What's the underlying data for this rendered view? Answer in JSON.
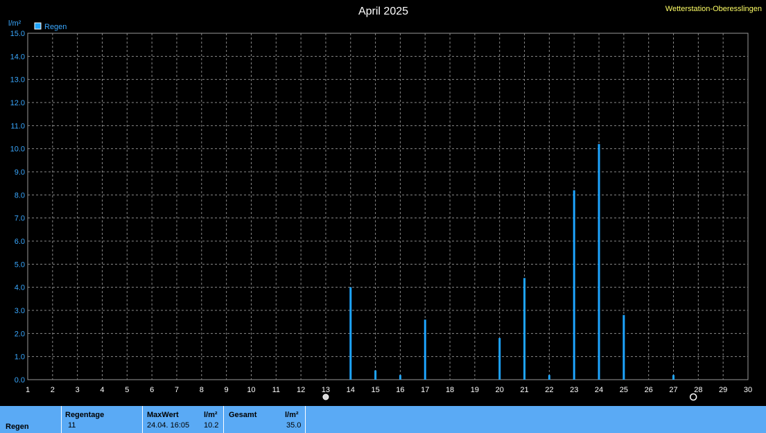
{
  "station": "Wetterstation-Oberesslingen",
  "chart_data": {
    "type": "bar",
    "title": "April 2025",
    "ylabel": "l/m²",
    "ylim": [
      0,
      15
    ],
    "xlim": [
      1,
      30
    ],
    "grid": true,
    "legend_placement": "top-left",
    "y_ticks": [
      "0.0",
      "1.0",
      "2.0",
      "3.0",
      "4.0",
      "5.0",
      "6.0",
      "7.0",
      "8.0",
      "9.0",
      "10.0",
      "11.0",
      "12.0",
      "13.0",
      "14.0",
      "15.0"
    ],
    "x_ticks": [
      "1",
      "2",
      "3",
      "4",
      "5",
      "6",
      "7",
      "8",
      "9",
      "10",
      "11",
      "12",
      "13",
      "14",
      "15",
      "16",
      "17",
      "18",
      "19",
      "20",
      "21",
      "22",
      "23",
      "24",
      "25",
      "26",
      "27",
      "28",
      "29",
      "30"
    ],
    "series": [
      {
        "name": "Regen",
        "color": "#1ea5ff",
        "points": [
          {
            "x": 14,
            "y": 4.0
          },
          {
            "x": 15,
            "y": 0.4
          },
          {
            "x": 16,
            "y": 0.2
          },
          {
            "x": 17,
            "y": 2.6
          },
          {
            "x": 20,
            "y": 1.8
          },
          {
            "x": 21,
            "y": 4.4
          },
          {
            "x": 22,
            "y": 0.2
          },
          {
            "x": 23,
            "y": 8.2
          },
          {
            "x": 24,
            "y": 10.2
          },
          {
            "x": 25,
            "y": 2.8
          },
          {
            "x": 27,
            "y": 0.2
          }
        ]
      }
    ],
    "moon_phases": [
      {
        "day": 13,
        "phase": "full-moon"
      },
      {
        "day": 27.8,
        "phase": "new-moon"
      }
    ]
  },
  "footer": {
    "row_label": "Regen",
    "regentage_header": "Regentage",
    "regentage_value": "11",
    "maxwert_header": "MaxWert",
    "maxwert_unit": "l/m²",
    "maxwert_time": "24.04.  16:05",
    "maxwert_value": "10.2",
    "gesamt_header": "Gesamt",
    "gesamt_unit": "l/m²",
    "gesamt_value": "35.0"
  },
  "colors": {
    "background": "#000000",
    "axis_text": "#3aa8ff",
    "station_text": "#ffff66",
    "footer_bg": "#5aaaf5",
    "grid": "#8a8a8a"
  }
}
